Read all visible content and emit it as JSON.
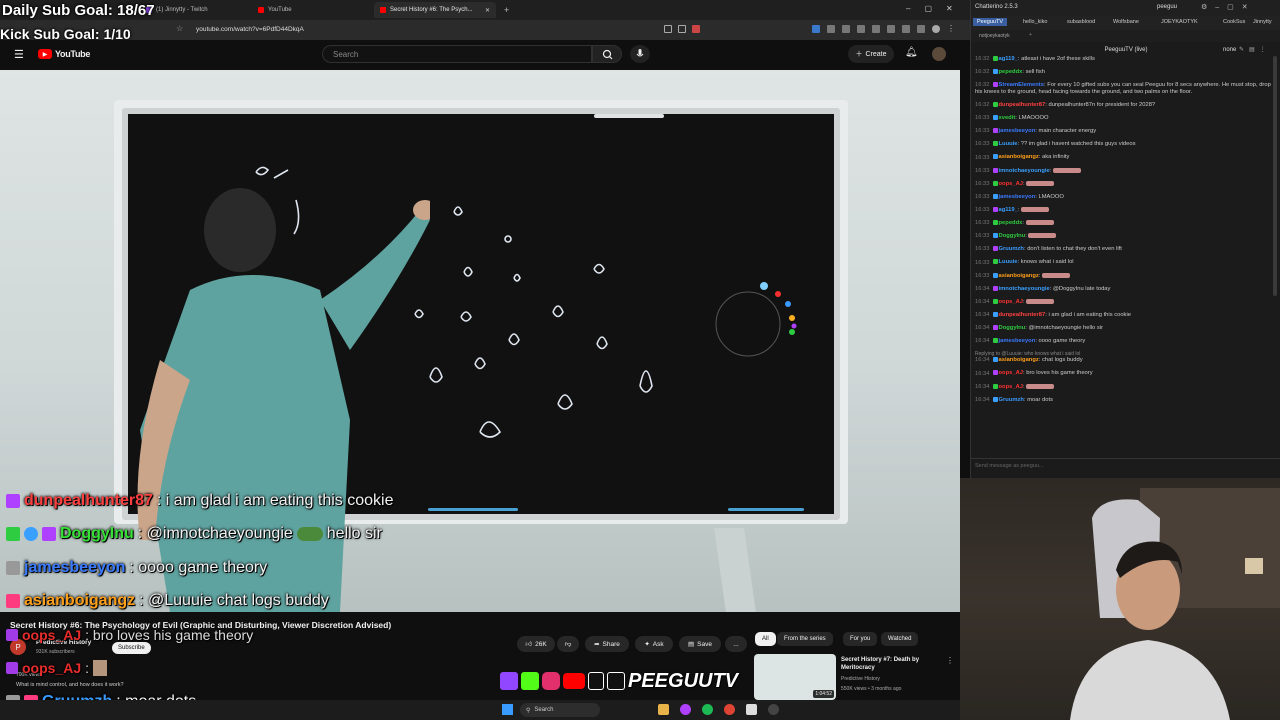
{
  "overlay_goals": {
    "sub_goal": "Daily Sub Goal: 18/67",
    "kick_goal": "Kick Sub Goal: 1/10"
  },
  "browser": {
    "tabs": [
      {
        "label": "(1) Jinnytty - Twitch",
        "color": "#9146ff"
      },
      {
        "label": "YouTube",
        "color": "#ff0000"
      },
      {
        "label": "Secret History #6: The Psych...",
        "color": "#ff0000",
        "active": true
      }
    ],
    "new_tab": "+",
    "url": "youtube.com/watch?v=6PdfD44DkqA"
  },
  "youtube": {
    "logo_text": "YouTube",
    "search_placeholder": "Search",
    "create_label": "Create",
    "video_title": "Secret History #6: The Psychology of Evil (Graphic and Disturbing, Viewer Discretion Advised)",
    "channel": {
      "name": "Predictive History",
      "subscribers": "931K subscribers",
      "avatar_letter": "P"
    },
    "subscribe_label": "Subscribe",
    "views_text": "700K views",
    "description_snippet": "What is mind control, and how does it work?",
    "actions": {
      "likes": "26K",
      "share": "Share",
      "ask": "Ask",
      "save": "Save",
      "more": "..."
    },
    "chips": [
      "All",
      "From the series",
      "For you",
      "Watched"
    ],
    "suggested": {
      "title": "Secret History #7: Death by Meritocracy",
      "channel": "Predictive History",
      "meta": "550K views • 3 months ago",
      "duration": "1:04:52"
    }
  },
  "chat_overlay": [
    {
      "user": "dunpealhunter87",
      "text": " : i am glad i am eating this cookie",
      "color": "#ff4040",
      "badges": [
        "#b040ff"
      ]
    },
    {
      "user": "DoggyInu",
      "text": " : @imnotchaeyoungie",
      "extra": "hello sir",
      "color": "#36e036",
      "badges": [
        "#2ecc40",
        "#3aa0ff",
        "#b040ff"
      ]
    },
    {
      "user": "jamesbeeyon",
      "text": " : oooo game theory",
      "color": "#3a7bff",
      "badges": [
        "#999999"
      ]
    },
    {
      "user": "asianboigangz",
      "text": " : @Luuuie chat logs buddy",
      "color": "#ff9f1a",
      "badges": [
        "#ff3b7f"
      ]
    },
    {
      "user": "oops_AJ",
      "text": " : bro loves his game theory",
      "color": "#ff3030",
      "badges": [
        "#b040ff"
      ]
    },
    {
      "user": "oops_AJ",
      "text": " : ",
      "color": "#ff3030",
      "badges": [
        "#b040ff"
      ]
    },
    {
      "user": "Gruumzh",
      "text": " : moar dots",
      "color": "#3a9bff",
      "badges": [
        "#999999",
        "#ff3b7f"
      ]
    }
  ],
  "taskbar": {
    "search_label": "Search"
  },
  "chatterino": {
    "title": "Chatterino 2.5.3",
    "account": "peeguu",
    "tabs": [
      "PeeguuTV",
      "hello_kiko",
      "subasblood",
      "Wolfsbane",
      "JOEYKAOTYK",
      "CookSus",
      "Jinnytty"
    ],
    "sub_tab": "notjoeykaotyk",
    "channel_label": "PeeguuTV (live)",
    "mode_label": "none",
    "input_placeholder": "Send message as peeguu...",
    "messages": [
      {
        "ts": "16:32",
        "user": "ag119_",
        "text": "atleast i have 2of these skills",
        "color": "#3aa0ff"
      },
      {
        "ts": "16:32",
        "user": "pepeddx",
        "text": "sell fish",
        "color": "#2ecc40"
      },
      {
        "ts": "16:32",
        "user": "StreamElements",
        "text": "For every 10 gifted subs you can seal Peeguu for 8 secs anywhere. He must stop, drop his knees to the ground, head facing towards the ground, and two palms on the floor.",
        "color": "#3a7bff"
      },
      {
        "ts": "16:32",
        "user": "dunpealhunter87",
        "text": "dunpealhunter87n for president for 2028?",
        "color": "#ff4040"
      },
      {
        "ts": "16:33",
        "user": "xvedit",
        "text": "LMAOOOO",
        "color": "#2ecc40"
      },
      {
        "ts": "16:33",
        "user": "jamesbeeyon",
        "text": "main character energy",
        "color": "#3a7bff"
      },
      {
        "ts": "16:33",
        "user": "Luuuie",
        "text": "?? im glad i havent watched this guys videos",
        "color": "#3aa0ff"
      },
      {
        "ts": "16:33",
        "user": "asianboigangz",
        "text": "aka infinity",
        "color": "#ff9f1a"
      },
      {
        "ts": "16:33",
        "user": "imnotchaeyoungie",
        "text": "",
        "color": "#3aa0ff"
      },
      {
        "ts": "16:33",
        "user": "oops_AJ",
        "text": "",
        "color": "#ff3030"
      },
      {
        "ts": "16:33",
        "user": "jamesbeeyon",
        "text": "LMAOOO",
        "color": "#3a7bff"
      },
      {
        "ts": "16:33",
        "user": "ag119_",
        "text": "",
        "color": "#3aa0ff"
      },
      {
        "ts": "16:33",
        "user": "pepeddx",
        "text": "",
        "color": "#2ecc40"
      },
      {
        "ts": "16:33",
        "user": "DoggyInu",
        "text": "",
        "color": "#2ecc40"
      },
      {
        "ts": "16:33",
        "user": "Gruumzh",
        "text": "don't listen to chat they don't even lift",
        "color": "#3a9bff"
      },
      {
        "ts": "16:33",
        "user": "Luuuie",
        "text": "knows what i said lol",
        "color": "#3aa0ff"
      },
      {
        "ts": "16:33",
        "user": "asianboigangz",
        "text": "",
        "color": "#ff9f1a"
      },
      {
        "ts": "16:34",
        "user": "imnotchaeyoungie",
        "text": "@DoggyInu late today",
        "color": "#3aa0ff"
      },
      {
        "ts": "16:34",
        "user": "oops_AJ",
        "text": "",
        "color": "#ff3030"
      },
      {
        "ts": "16:34",
        "user": "dunpealhunter87",
        "text": "i am glad i am eating this cookie",
        "color": "#ff4040"
      },
      {
        "ts": "16:34",
        "user": "DoggyInu",
        "text": "@imnotchaeyoungie hello sir",
        "color": "#2ecc40"
      },
      {
        "ts": "16:34",
        "user": "jamesbeeyon",
        "text": "oooo game theory",
        "color": "#3a7bff"
      },
      {
        "ts": "16:34",
        "user": "asianboigangz",
        "text": "chat logs buddy",
        "color": "#ff9f1a"
      },
      {
        "ts": "16:34",
        "user": "oops_AJ",
        "text": "bro loves his game theory",
        "color": "#ff3030"
      },
      {
        "ts": "16:34",
        "user": "oops_AJ",
        "text": "",
        "color": "#ff3030"
      },
      {
        "ts": "16:34",
        "user": "Gruumzh",
        "text": "moar dots",
        "color": "#3a9bff"
      }
    ],
    "reply_context": "Replying to @Luuuie: who knows what i said lol"
  },
  "streamer_logo": "PEEGUUTV",
  "colors": {
    "yt_bg": "#0f0f0f",
    "yt_red": "#ff0000",
    "twitch": "#9146ff",
    "kick": "#53fc18"
  }
}
